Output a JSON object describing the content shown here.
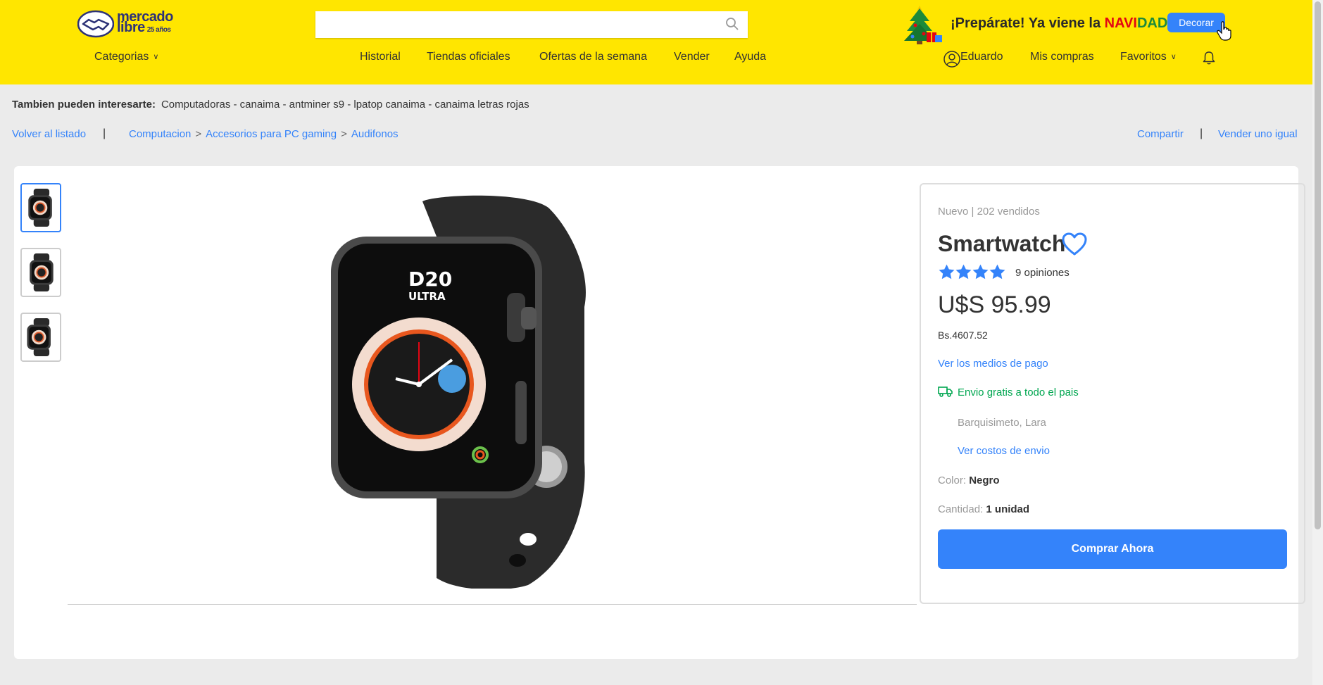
{
  "header": {
    "logo": {
      "line1": "mercado",
      "line2": "libre",
      "badge": "25 años"
    },
    "search": {
      "value": "",
      "placeholder": ""
    },
    "promo": {
      "text": "¡Prepárate! Ya viene la",
      "highlight_red": "NAVI",
      "highlight_green": "DAD",
      "button_label": "Decorar"
    },
    "categories_label": "Categorias",
    "nav": [
      "Historial",
      "Tiendas oficiales",
      "Ofertas de la semana",
      "Vender",
      "Ayuda"
    ],
    "user_name": "Eduardo",
    "purchases_label": "Mis compras",
    "favorites_label": "Favoritos",
    "colors": {
      "brand_yellow": "#ffe600",
      "accent_blue": "#3483fa",
      "ship_green": "#00a650"
    }
  },
  "suggestions": {
    "label": "Tambien pueden interesarte:",
    "items": "Computadoras - canaima - antminer s9 - lpatop canaima - canaima letras rojas"
  },
  "breadcrumb": {
    "back": "Volver al listado",
    "path": [
      "Computacion",
      "Accesorios para PC gaming",
      "Audifonos"
    ],
    "share": "Compartir",
    "sell_same": "Vender uno igual"
  },
  "product": {
    "condition": "Nuevo | 202 vendidos",
    "title": "Smartwatch",
    "rating": 4,
    "reviews": "9 opiniones",
    "price": "U$S 95.99",
    "price_local": "Bs.4607.52",
    "payment_link": "Ver los medios de pago",
    "shipping": "Envio gratis a todo el pais",
    "location": "Barquisimeto, Lara",
    "shipping_cost_link": "Ver costos de envio",
    "color_label": "Color:",
    "color_value": "Negro",
    "qty_label": "Cantidad:",
    "qty_value": "1 unidad",
    "buy_label": "Comprar Ahora",
    "watch_brand": "D20",
    "watch_model": "ULTRA"
  }
}
